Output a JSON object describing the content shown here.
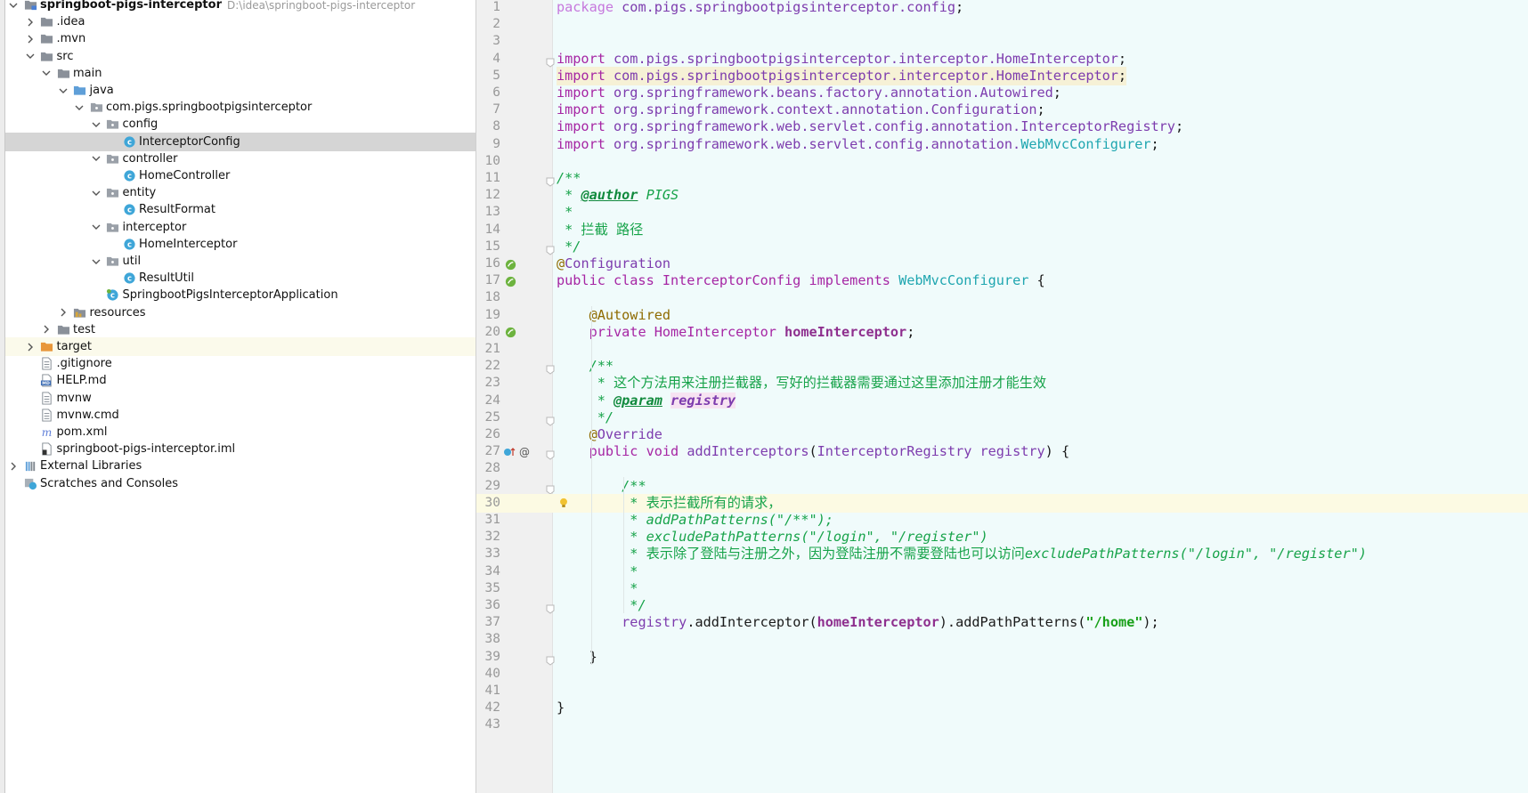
{
  "project_tree": {
    "rows": [
      {
        "label": "springboot-pigs-interceptor",
        "path": "D:\\idea\\springboot-pigs-interceptor",
        "icon": "module-folder-icon",
        "depth": 0,
        "arrow": "down",
        "bold": true
      },
      {
        "label": ".idea",
        "icon": "folder-icon",
        "depth": 1,
        "arrow": "right"
      },
      {
        "label": ".mvn",
        "icon": "folder-icon",
        "depth": 1,
        "arrow": "right"
      },
      {
        "label": "src",
        "icon": "folder-icon",
        "depth": 1,
        "arrow": "down"
      },
      {
        "label": "main",
        "icon": "folder-icon",
        "depth": 2,
        "arrow": "down"
      },
      {
        "label": "java",
        "icon": "source-folder-icon",
        "depth": 3,
        "arrow": "down"
      },
      {
        "label": "com.pigs.springbootpigsinterceptor",
        "icon": "package-icon",
        "depth": 4,
        "arrow": "down"
      },
      {
        "label": "config",
        "icon": "package-icon",
        "depth": 5,
        "arrow": "down"
      },
      {
        "label": "InterceptorConfig",
        "icon": "class-icon",
        "depth": 6,
        "arrow": "none",
        "selected": true
      },
      {
        "label": "controller",
        "icon": "package-icon",
        "depth": 5,
        "arrow": "down"
      },
      {
        "label": "HomeController",
        "icon": "class-icon",
        "depth": 6,
        "arrow": "none"
      },
      {
        "label": "entity",
        "icon": "package-icon",
        "depth": 5,
        "arrow": "down"
      },
      {
        "label": "ResultFormat",
        "icon": "class-icon",
        "depth": 6,
        "arrow": "none"
      },
      {
        "label": "interceptor",
        "icon": "package-icon",
        "depth": 5,
        "arrow": "down"
      },
      {
        "label": "HomeInterceptor",
        "icon": "class-icon",
        "depth": 6,
        "arrow": "none"
      },
      {
        "label": "util",
        "icon": "package-icon",
        "depth": 5,
        "arrow": "down"
      },
      {
        "label": "ResultUtil",
        "icon": "class-icon",
        "depth": 6,
        "arrow": "none"
      },
      {
        "label": "SpringbootPigsInterceptorApplication",
        "icon": "spring-class-icon",
        "depth": 5,
        "arrow": "none"
      },
      {
        "label": "resources",
        "icon": "resources-folder-icon",
        "depth": 3,
        "arrow": "right"
      },
      {
        "label": "test",
        "icon": "folder-icon",
        "depth": 2,
        "arrow": "right"
      },
      {
        "label": "target",
        "icon": "excluded-folder-icon",
        "depth": 1,
        "arrow": "right",
        "highlight": true
      },
      {
        "label": ".gitignore",
        "icon": "text-file-icon",
        "depth": 1,
        "arrow": "none"
      },
      {
        "label": "HELP.md",
        "icon": "markdown-file-icon",
        "depth": 1,
        "arrow": "none"
      },
      {
        "label": "mvnw",
        "icon": "text-file-icon",
        "depth": 1,
        "arrow": "none"
      },
      {
        "label": "mvnw.cmd",
        "icon": "text-file-icon",
        "depth": 1,
        "arrow": "none"
      },
      {
        "label": "pom.xml",
        "icon": "maven-icon",
        "depth": 1,
        "arrow": "none"
      },
      {
        "label": "springboot-pigs-interceptor.iml",
        "icon": "iml-file-icon",
        "depth": 1,
        "arrow": "none"
      },
      {
        "label": "External Libraries",
        "icon": "libraries-icon",
        "depth": 0,
        "arrow": "right"
      },
      {
        "label": "Scratches and Consoles",
        "icon": "scratches-icon",
        "depth": 0,
        "arrow": "none"
      }
    ]
  },
  "editor": {
    "caret_line": 30,
    "lines": [
      {
        "n": "1",
        "t": [
          [
            "k",
            "package "
          ],
          [
            "pkg",
            "com.pigs.springbootpigsinterceptor.config"
          ],
          [
            "plain",
            ";"
          ]
        ]
      },
      {
        "n": "2",
        "t": []
      },
      {
        "n": "3",
        "t": []
      },
      {
        "n": "4",
        "fold": true,
        "t": [
          [
            "kw",
            "import "
          ],
          [
            "pkg",
            "com.pigs.springbootpigsinterceptor.interceptor.HomeInterceptor"
          ],
          [
            "plain",
            ";"
          ]
        ]
      },
      {
        "n": "5",
        "hl": true,
        "t": [
          [
            "kw",
            "import "
          ],
          [
            "pkg",
            "com.pigs.springbootpigsinterceptor.interceptor.HomeInterceptor"
          ],
          [
            "plain",
            ";"
          ]
        ]
      },
      {
        "n": "6",
        "t": [
          [
            "kw",
            "import "
          ],
          [
            "pkg",
            "org.springframework.beans.factory.annotation.Autowired"
          ],
          [
            "plain",
            ";"
          ]
        ]
      },
      {
        "n": "7",
        "t": [
          [
            "kw",
            "import "
          ],
          [
            "pkg",
            "org.springframework.context.annotation.Configuration"
          ],
          [
            "plain",
            ";"
          ]
        ]
      },
      {
        "n": "8",
        "t": [
          [
            "kw",
            "import "
          ],
          [
            "pkg",
            "org.springframework.web.servlet.config.annotation.InterceptorRegistry"
          ],
          [
            "plain",
            ";"
          ]
        ]
      },
      {
        "n": "9",
        "t": [
          [
            "kw",
            "import "
          ],
          [
            "pkg",
            "org.springframework.web.servlet.config.annotation."
          ],
          [
            "cls2",
            "WebMvcConfigurer"
          ],
          [
            "plain",
            ";"
          ]
        ]
      },
      {
        "n": "10",
        "t": []
      },
      {
        "n": "11",
        "fold": true,
        "t": [
          [
            "cmt",
            "/**"
          ]
        ]
      },
      {
        "n": "12",
        "t": [
          [
            "cmt",
            " * "
          ],
          [
            "tag",
            "@author"
          ],
          [
            "cmt",
            " PIGS"
          ]
        ]
      },
      {
        "n": "13",
        "t": [
          [
            "cmt",
            " *"
          ]
        ]
      },
      {
        "n": "14",
        "t": [
          [
            "cmt-n",
            " * 拦截 路径"
          ]
        ]
      },
      {
        "n": "15",
        "fold": true,
        "t": [
          [
            "cmt",
            " */"
          ]
        ]
      },
      {
        "n": "16",
        "gicon": "spring-bean-icon",
        "t": [
          [
            "ann",
            "@"
          ],
          [
            "pkg",
            "Configuration"
          ]
        ]
      },
      {
        "n": "17",
        "gicon": "spring-bean-icon",
        "t": [
          [
            "kw",
            "public class "
          ],
          [
            "cls",
            "InterceptorConfig "
          ],
          [
            "kw",
            "implements "
          ],
          [
            "cls2",
            "WebMvcConfigurer "
          ],
          [
            "plain",
            "{"
          ]
        ]
      },
      {
        "n": "18",
        "t": []
      },
      {
        "n": "19",
        "t": [
          [
            "plain",
            "    "
          ],
          [
            "ann",
            "@Autowired"
          ]
        ]
      },
      {
        "n": "20",
        "gicon": "spring-bean-icon",
        "t": [
          [
            "plain",
            "    "
          ],
          [
            "kw",
            "private "
          ],
          [
            "cls",
            "HomeInterceptor "
          ],
          [
            "field",
            "homeInterceptor"
          ],
          [
            "plain",
            ";"
          ]
        ]
      },
      {
        "n": "21",
        "t": []
      },
      {
        "n": "22",
        "fold": true,
        "t": [
          [
            "plain",
            "    "
          ],
          [
            "cmt",
            "/**"
          ]
        ]
      },
      {
        "n": "23",
        "t": [
          [
            "plain",
            "    "
          ],
          [
            "cmt-n",
            " * 这个方法用来注册拦截器，写好的拦截器需要通过这里添加注册才能生效"
          ]
        ]
      },
      {
        "n": "24",
        "t": [
          [
            "plain",
            "    "
          ],
          [
            "cmt",
            " * "
          ],
          [
            "tag",
            "@param"
          ],
          [
            "cmt",
            " "
          ],
          [
            "param",
            "registry"
          ]
        ]
      },
      {
        "n": "25",
        "fold": true,
        "t": [
          [
            "plain",
            "    "
          ],
          [
            "cmt",
            " */"
          ]
        ]
      },
      {
        "n": "26",
        "t": [
          [
            "plain",
            "    "
          ],
          [
            "ann",
            "@"
          ],
          [
            "pkg",
            "Override"
          ]
        ]
      },
      {
        "n": "27",
        "gicon": "override-icon",
        "fold": true,
        "t": [
          [
            "plain",
            "    "
          ],
          [
            "kw",
            "public void "
          ],
          [
            "pkg",
            "addInterceptors"
          ],
          [
            "plain",
            "("
          ],
          [
            "pkg",
            "InterceptorRegistry registry"
          ],
          [
            "plain",
            ") {"
          ]
        ]
      },
      {
        "n": "28",
        "t": []
      },
      {
        "n": "29",
        "fold": true,
        "t": [
          [
            "plain",
            "        "
          ],
          [
            "cmt",
            "/**"
          ]
        ]
      },
      {
        "n": "30",
        "bulb": true,
        "t": [
          [
            "plain",
            "        "
          ],
          [
            "cmt-n",
            " * 表示拦截所有的请求，"
          ]
        ]
      },
      {
        "n": "31",
        "t": [
          [
            "plain",
            "        "
          ],
          [
            "cmt",
            " * addPathPatterns(\"/**\");"
          ]
        ]
      },
      {
        "n": "32",
        "t": [
          [
            "plain",
            "        "
          ],
          [
            "cmt",
            " * excludePathPatterns(\"/login\", \"/register\")"
          ]
        ]
      },
      {
        "n": "33",
        "t": [
          [
            "plain",
            "        "
          ],
          [
            "cmt-n",
            " * 表示除了登陆与注册之外，因为登陆注册不需要登陆也可以访问"
          ],
          [
            "cmt",
            "excludePathPatterns(\"/login\", \"/register\")"
          ]
        ]
      },
      {
        "n": "34",
        "t": [
          [
            "plain",
            "        "
          ],
          [
            "cmt",
            " *"
          ]
        ]
      },
      {
        "n": "35",
        "t": [
          [
            "plain",
            "        "
          ],
          [
            "cmt",
            " *"
          ]
        ]
      },
      {
        "n": "36",
        "fold": true,
        "t": [
          [
            "plain",
            "        "
          ],
          [
            "cmt",
            " */"
          ]
        ]
      },
      {
        "n": "37",
        "t": [
          [
            "plain",
            "        "
          ],
          [
            "pkg",
            "registry"
          ],
          [
            "plain",
            "."
          ],
          [
            "plain",
            "addInterceptor("
          ],
          [
            "field",
            "homeInterceptor"
          ],
          [
            "plain",
            ")."
          ],
          [
            "plain",
            "addPathPatterns("
          ],
          [
            "str",
            "\"/home\""
          ],
          [
            "plain",
            ");"
          ]
        ]
      },
      {
        "n": "38",
        "t": []
      },
      {
        "n": "39",
        "fold": true,
        "t": [
          [
            "plain",
            "    }"
          ]
        ]
      },
      {
        "n": "40",
        "t": []
      },
      {
        "n": "41",
        "t": []
      },
      {
        "n": "42",
        "t": [
          [
            "plain",
            "}"
          ]
        ]
      },
      {
        "n": "43",
        "t": []
      }
    ]
  }
}
